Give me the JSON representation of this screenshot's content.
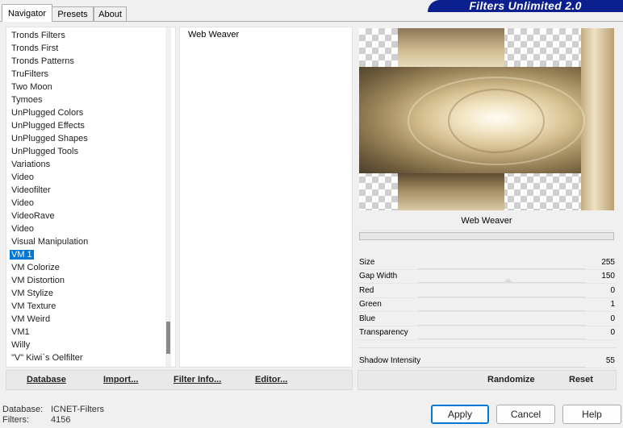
{
  "tabs": [
    {
      "label": "Navigator",
      "active": true
    },
    {
      "label": "Presets",
      "active": false
    },
    {
      "label": "About",
      "active": false
    }
  ],
  "brand": "Filters Unlimited 2.0",
  "categories": [
    "Tronds Filters",
    "Tronds First",
    "Tronds Patterns",
    "TruFilters",
    "Two Moon",
    "Tymoes",
    "UnPlugged Colors",
    "UnPlugged Effects",
    "UnPlugged Shapes",
    "UnPlugged Tools",
    "Variations",
    "Video",
    "Videofilter",
    "Video",
    "VideoRave",
    "Video",
    "Visual Manipulation",
    "VM 1",
    "VM Colorize",
    "VM Distortion",
    "VM Stylize",
    "VM Texture",
    "VM Weird",
    "VM1",
    "Willy",
    "\"V\" Kiwi`s Oelfilter"
  ],
  "selected_category": "VM 1",
  "filters": [
    "Web Weaver"
  ],
  "preview_label": "Web Weaver",
  "progress": 0,
  "params": [
    {
      "name": "Size",
      "value": "255"
    },
    {
      "name": "Gap Width",
      "value": "150"
    },
    {
      "name": "Red",
      "value": "0"
    },
    {
      "name": "Green",
      "value": "1"
    },
    {
      "name": "Blue",
      "value": "0"
    },
    {
      "name": "Transparency",
      "value": "0"
    },
    {
      "name": "Shadow Intensity",
      "value": "55"
    }
  ],
  "toolbar": {
    "database": "Database",
    "import": "Import...",
    "filter_info": "Filter Info...",
    "editor": "Editor...",
    "randomize": "Randomize",
    "reset": "Reset"
  },
  "status": {
    "database_label": "Database:",
    "database_value": "ICNET-Filters",
    "filters_label": "Filters:",
    "filters_value": "4156"
  },
  "buttons": {
    "apply": "Apply",
    "cancel": "Cancel",
    "help": "Help"
  },
  "colors": {
    "brand_bg": "#0b1f8f",
    "selection": "#0078d7"
  }
}
